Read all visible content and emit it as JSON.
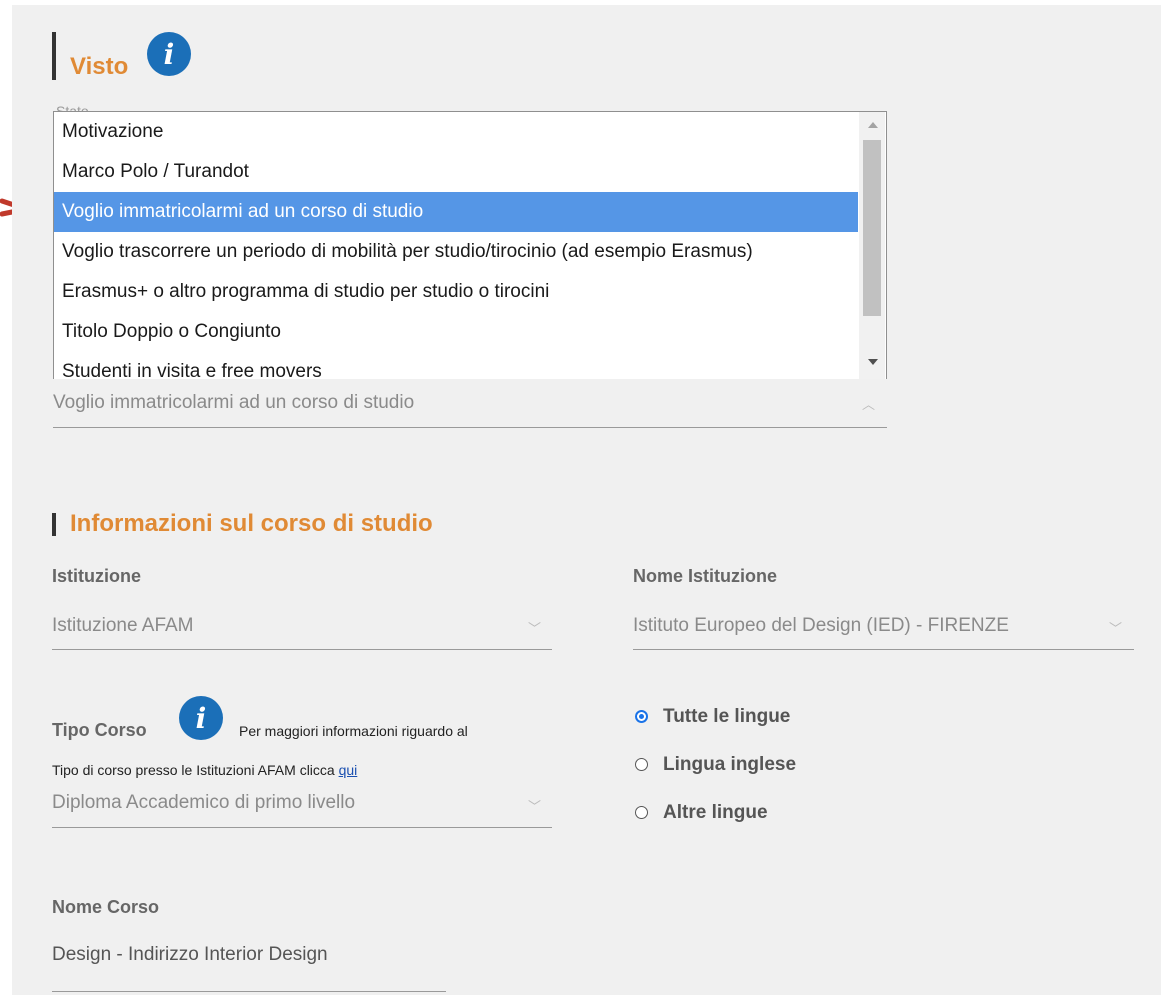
{
  "visto": {
    "title": "Visto",
    "hidden_label_fragment": "Stato",
    "options": [
      "Motivazione",
      "Marco Polo / Turandot",
      "Voglio immatricolarmi ad un corso di studio",
      "Voglio trascorrere un periodo di mobilità per studio/tirocinio (ad esempio Erasmus)",
      "Erasmus+ o altro programma di studio per studio o tirocini",
      "Titolo Doppio o Congiunto",
      "Studenti in visita e free movers"
    ],
    "selected_index": 2,
    "selected_value": "Voglio immatricolarmi ad un corso di studio",
    "selected_color": "#5596e6"
  },
  "course_info": {
    "title": "Informazioni sul corso di studio",
    "accent_color": "#e08a35",
    "istituzione": {
      "label": "Istituzione",
      "value": "Istituzione AFAM"
    },
    "nome_istituzione": {
      "label": "Nome Istituzione",
      "value": "Istituto Europeo del Design (IED) - FIRENZE"
    },
    "tipo_corso": {
      "label": "Tipo Corso",
      "help_text_1": "Per maggiori informazioni riguardo al",
      "help_text_2": "Tipo di corso presso le Istituzioni AFAM clicca",
      "help_link": "qui",
      "value": "Diploma Accademico di primo livello"
    },
    "languages": [
      {
        "label": "Tutte le lingue",
        "checked": true
      },
      {
        "label": "Lingua inglese",
        "checked": false
      },
      {
        "label": "Altre lingue",
        "checked": false
      }
    ],
    "nome_corso": {
      "label": "Nome Corso",
      "value": "Design - Indirizzo Interior Design"
    }
  },
  "icons": {
    "info": "info-icon",
    "cursor_marker": "click-burst-icon",
    "marker_color": "#c0392b"
  }
}
